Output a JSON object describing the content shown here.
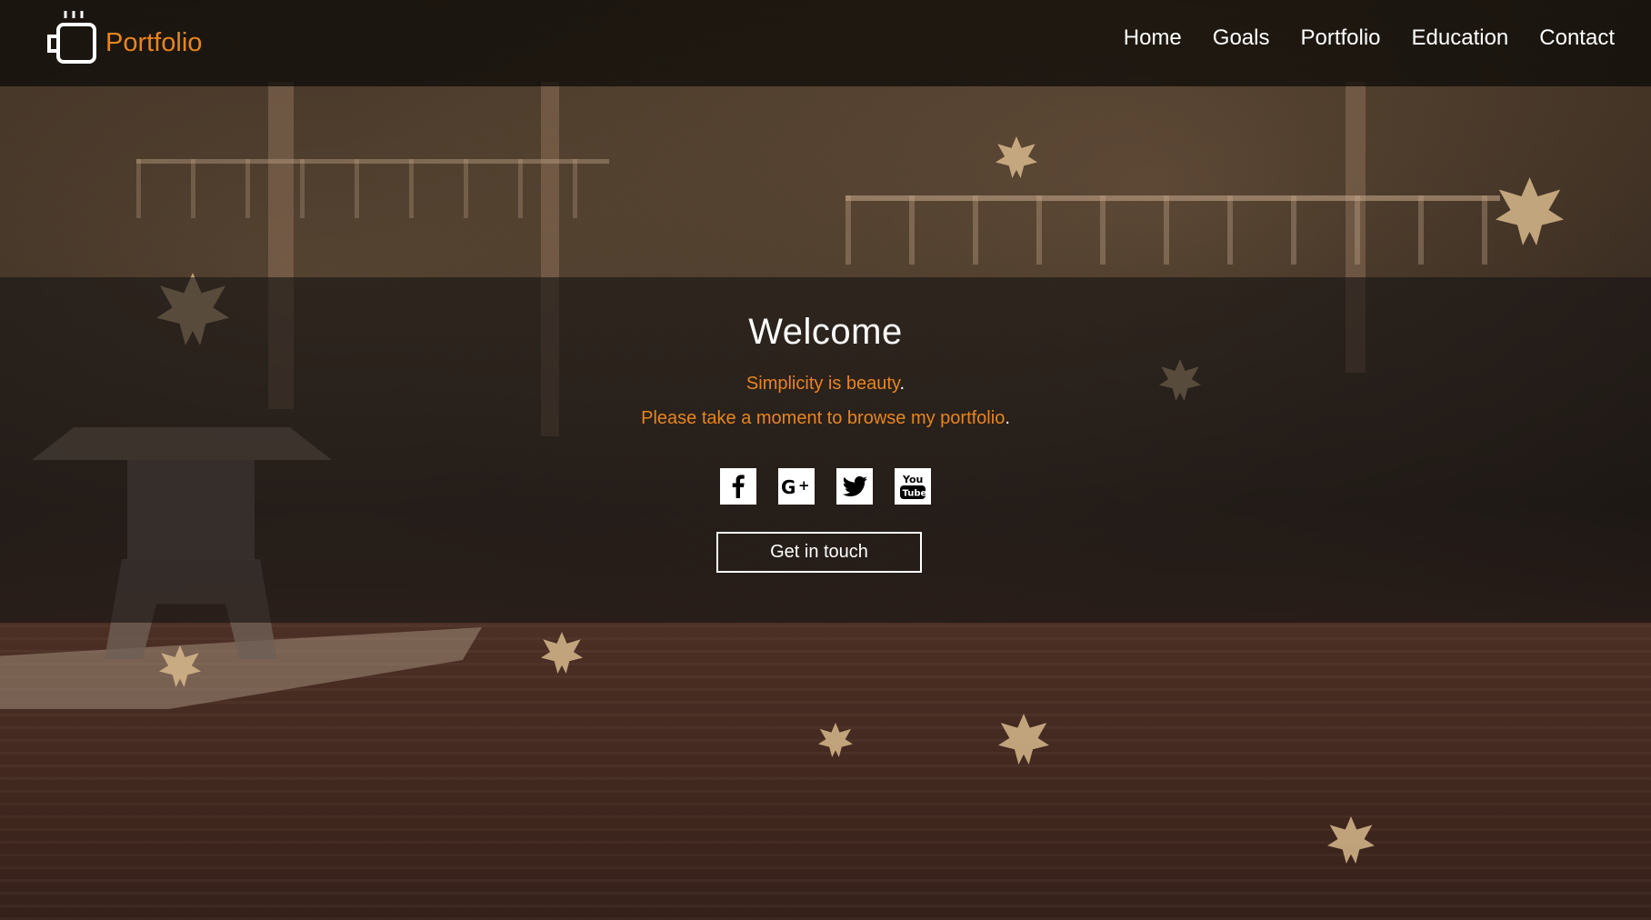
{
  "header": {
    "logo_text": "Portfolio",
    "nav": [
      "Home",
      "Goals",
      "Portfolio",
      "Education",
      "Contact"
    ]
  },
  "hero": {
    "title": "Welcome",
    "tagline_1": "Simplicity is beauty",
    "tagline_2": "Please take a moment to browse my portfolio",
    "punctuation": ".",
    "socials": [
      "facebook-icon",
      "google-plus-icon",
      "twitter-icon",
      "youtube-icon"
    ],
    "cta_label": "Get in touch"
  },
  "colors": {
    "accent": "#e8851f",
    "header_bg": "#0a0806",
    "text": "#ffffff"
  }
}
